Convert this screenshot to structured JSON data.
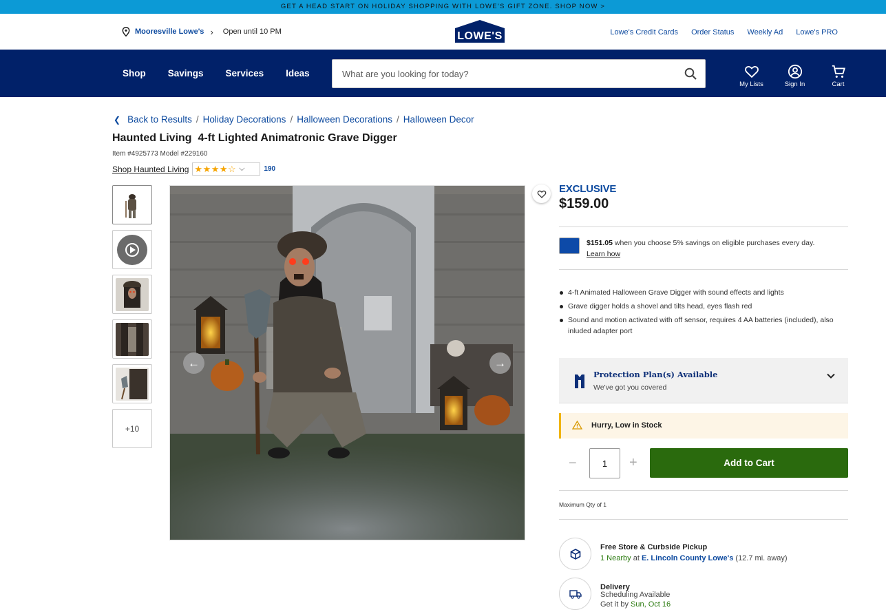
{
  "promo": {
    "text": "GET A HEAD START ON HOLIDAY SHOPPING WITH LOWE’S GIFT ZONE. SHOP NOW >"
  },
  "utility": {
    "store_name": "Mooresville Lowe's",
    "hours": "Open until 10 PM",
    "logo_text": "LOWE'S",
    "links": [
      "Lowe's Credit Cards",
      "Order Status",
      "Weekly Ad",
      "Lowe's PRO"
    ]
  },
  "nav": {
    "links": [
      "Shop",
      "Savings",
      "Services",
      "Ideas"
    ],
    "search_placeholder": "What are you looking for today?",
    "icons": [
      {
        "label": "My Lists",
        "icon": "heart-icon"
      },
      {
        "label": "Sign In",
        "icon": "user-icon"
      },
      {
        "label": "Cart",
        "icon": "cart-icon"
      }
    ]
  },
  "breadcrumb": {
    "back": "Back to Results",
    "items": [
      "Holiday Decorations",
      "Halloween Decorations",
      "Halloween Decor"
    ]
  },
  "product": {
    "title": "Haunted Living  4-ft Lighted Animatronic Grave Digger",
    "item_model": "Item #4925773 Model #229160",
    "shop_brand": "Shop Haunted Living",
    "rating": 3.5,
    "review_count": "190",
    "more_images": "+10",
    "badge": "EXCLUSIVE",
    "price": "$159.00"
  },
  "card_offer": {
    "amount": "$151.05",
    "text": " when you choose 5% savings on eligible purchases every day.",
    "learn": "Learn how"
  },
  "highlights": [
    "4-ft Animated Halloween Grave Digger with sound effects and lights",
    "Grave digger holds a shovel and tilts head, eyes flash red",
    "Sound and motion activated with off sensor, requires 4 AA batteries (included), also inluded adapter port"
  ],
  "protection": {
    "title": "Protection Plan(s) Available",
    "subtitle": "We've got you covered"
  },
  "stock_alert": "Hurry, Low in Stock",
  "cart": {
    "qty": "1",
    "add_label": "Add to Cart",
    "max_qty": "Maximum Qty of 1"
  },
  "fulfillment": {
    "pickup_title": "Free Store & Curbside Pickup",
    "pickup_nearby": "1 Nearby",
    "pickup_at": " at ",
    "pickup_store": "E. Lincoln County Lowe's",
    "pickup_distance": " (12.7 mi. away)",
    "delivery_title": "Delivery",
    "delivery_sched": "Scheduling Available",
    "delivery_get": "Get it by ",
    "delivery_date": "Sun, Oct 16"
  },
  "colors": {
    "brand_blue": "#012169",
    "link_blue": "#0d4a9f",
    "cart_green": "#2a6a0d",
    "promo_bg": "#0c9ad6"
  }
}
